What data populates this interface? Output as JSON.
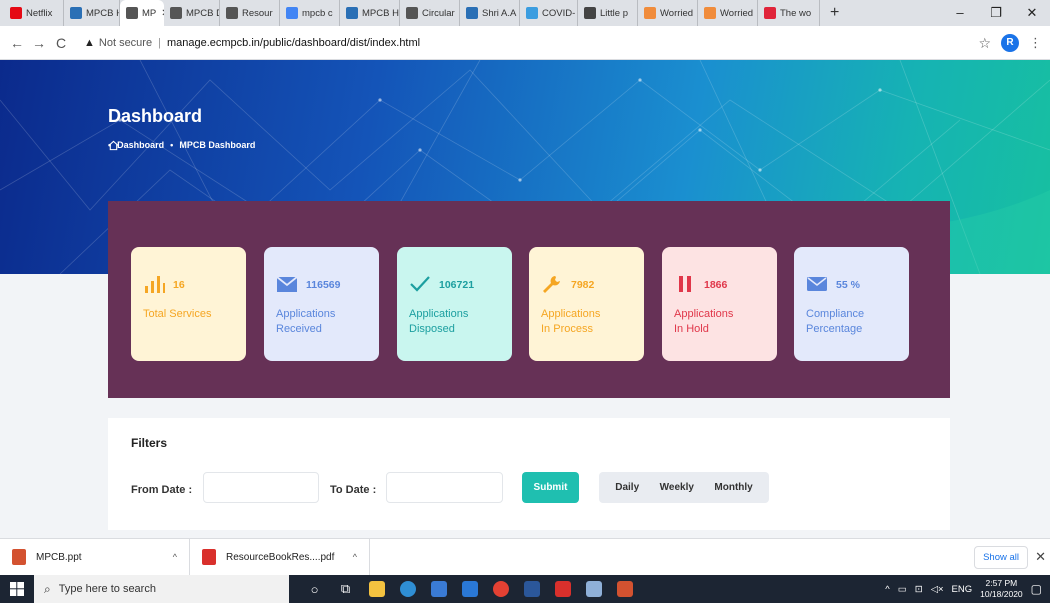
{
  "browser": {
    "tabs": [
      {
        "title": "Netflix",
        "icon": "netflix-icon",
        "color": "#e50914",
        "active": false
      },
      {
        "title": "MPCB H",
        "icon": "mpcb-icon",
        "color": "#2a6fb5",
        "active": false
      },
      {
        "title": "MP",
        "icon": "globe-icon",
        "color": "#555555",
        "active": true
      },
      {
        "title": "MPCB D",
        "icon": "globe-icon",
        "color": "#555555",
        "active": false
      },
      {
        "title": "Resour",
        "icon": "globe-icon",
        "color": "#555555",
        "active": false
      },
      {
        "title": "mpcb c",
        "icon": "google-icon",
        "color": "#4285f4",
        "active": false
      },
      {
        "title": "MPCB H",
        "icon": "mpcb-icon",
        "color": "#2a6fb5",
        "active": false
      },
      {
        "title": "Circular",
        "icon": "globe-icon",
        "color": "#555555",
        "active": false
      },
      {
        "title": "Shri A.A",
        "icon": "mpcb-icon",
        "color": "#2a6fb5",
        "active": false
      },
      {
        "title": "COVID-",
        "icon": "covid-icon",
        "color": "#3b9de0",
        "active": false
      },
      {
        "title": "Little p",
        "icon": "th-icon",
        "color": "#444444",
        "active": false
      },
      {
        "title": "Worried",
        "icon": "worried-icon",
        "color": "#f08c3c",
        "active": false
      },
      {
        "title": "Worried",
        "icon": "worried-icon",
        "color": "#f08c3c",
        "active": false
      },
      {
        "title": "The wo",
        "icon": "s-icon",
        "color": "#e0243a",
        "active": false
      }
    ],
    "new_tab": "+",
    "window_controls": [
      "–",
      "❐",
      "✕"
    ],
    "security": "Not secure",
    "url": "manage.ecmpcb.in/public/dashboard/dist/index.html",
    "profile_initial": "R"
  },
  "page": {
    "title": "Dashboard",
    "breadcrumb": [
      "Dashboard",
      "MPCB Dashboard"
    ]
  },
  "stats": [
    {
      "value": "16",
      "label_1": "Total Services",
      "label_2": "",
      "icon": "bar-chart-icon",
      "bg": "#fff4d6",
      "fg": "#f5a623"
    },
    {
      "value": "116569",
      "label_1": "Applications",
      "label_2": "Received",
      "icon": "inbox-icon",
      "bg": "#e3e9fb",
      "fg": "#5a86dc"
    },
    {
      "value": "106721",
      "label_1": "Applications",
      "label_2": "Disposed",
      "icon": "check-icon",
      "bg": "#c9f6ef",
      "fg": "#1c9fa0"
    },
    {
      "value": "7982",
      "label_1": "Applications",
      "label_2": "In Process",
      "icon": "wrench-icon",
      "bg": "#fff4d6",
      "fg": "#f5a623"
    },
    {
      "value": "1866",
      "label_1": "Applications",
      "label_2": "In Hold",
      "icon": "pause-icon",
      "bg": "#fde3e3",
      "fg": "#e0374a"
    },
    {
      "value": "55 %",
      "label_1": "Compliance",
      "label_2": "Percentage",
      "icon": "mail-icon",
      "bg": "#e3e9fb",
      "fg": "#5a86dc"
    }
  ],
  "filters": {
    "title": "Filters",
    "from_label": "From Date :",
    "to_label": "To Date :",
    "submit": "Submit",
    "segments": [
      "Daily",
      "Weekly",
      "Monthly"
    ]
  },
  "downloads": {
    "items": [
      {
        "name": "MPCB.ppt",
        "icon": "ppt-icon",
        "color": "#d35230"
      },
      {
        "name": "ResourceBookRes....pdf",
        "icon": "pdf-icon",
        "color": "#d9302c"
      }
    ],
    "show_all": "Show all",
    "close": "✕"
  },
  "taskbar": {
    "search_placeholder": "Type here to search",
    "apps": [
      {
        "icon": "cortana-icon",
        "glyph": "○"
      },
      {
        "icon": "task-view-icon",
        "glyph": "⧉"
      },
      {
        "icon": "file-explorer-icon",
        "glyph": "",
        "color": "#f3c240"
      },
      {
        "icon": "edge-icon",
        "glyph": "",
        "color": "#2f8fd5"
      },
      {
        "icon": "store-icon",
        "glyph": "",
        "color": "#3a7bd5"
      },
      {
        "icon": "mail-app-icon",
        "glyph": "",
        "color": "#2a78d6"
      },
      {
        "icon": "chrome-icon",
        "glyph": "",
        "color": "#e34133"
      },
      {
        "icon": "word-icon",
        "glyph": "",
        "color": "#2b579a"
      },
      {
        "icon": "acrobat-icon",
        "glyph": "",
        "color": "#d9302c"
      },
      {
        "icon": "paint-icon",
        "glyph": "",
        "color": "#8fb0d8"
      },
      {
        "icon": "powerpoint-icon",
        "glyph": "",
        "color": "#d35230"
      }
    ],
    "lang": "ENG",
    "time": "2:57 PM",
    "date": "10/18/2020"
  }
}
